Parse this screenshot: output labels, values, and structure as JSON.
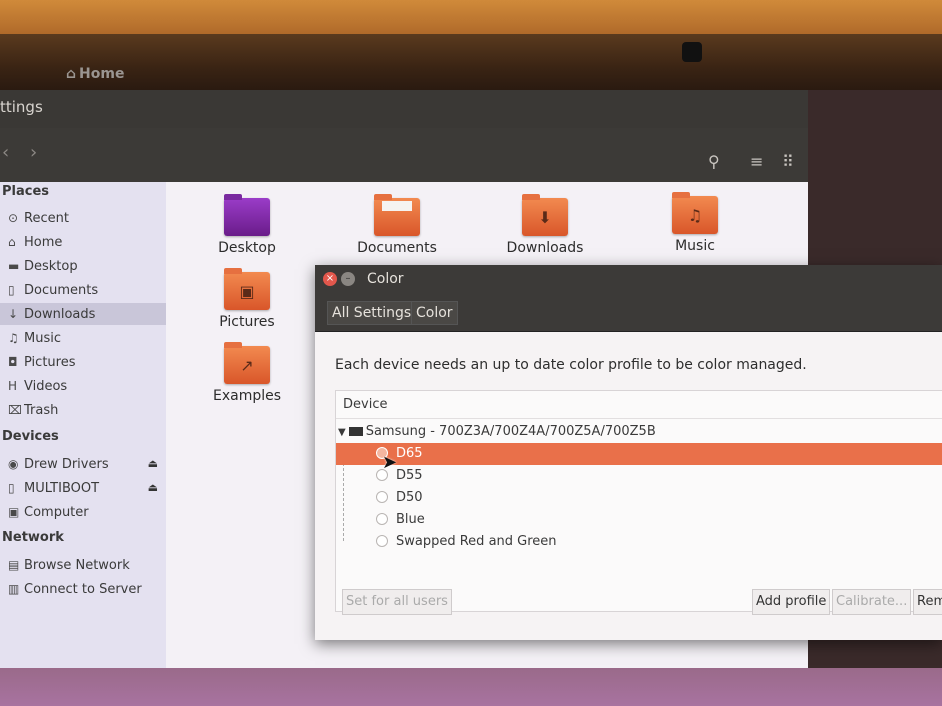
{
  "file_manager": {
    "window_title": "ttings",
    "breadcrumb": {
      "home": "Home"
    },
    "sidebar": {
      "places_label": "Places",
      "places": [
        {
          "label": "Recent",
          "icon": "clock-icon"
        },
        {
          "label": "Home",
          "icon": "home-icon"
        },
        {
          "label": "Desktop",
          "icon": "desktop-folder-icon"
        },
        {
          "label": "Documents",
          "icon": "document-icon"
        },
        {
          "label": "Downloads",
          "icon": "download-icon"
        },
        {
          "label": "Music",
          "icon": "music-icon"
        },
        {
          "label": "Pictures",
          "icon": "camera-icon"
        },
        {
          "label": "Videos",
          "icon": "film-icon"
        },
        {
          "label": "Trash",
          "icon": "trash-icon"
        }
      ],
      "devices_label": "Devices",
      "devices": [
        {
          "label": "Drew Drivers",
          "icon": "disc-icon"
        },
        {
          "label": "MULTIBOOT",
          "icon": "usb-icon"
        },
        {
          "label": "Computer",
          "icon": "computer-icon"
        }
      ],
      "network_label": "Network",
      "network": [
        {
          "label": "Browse Network",
          "icon": "network-icon"
        },
        {
          "label": "Connect to Server",
          "icon": "server-icon"
        }
      ]
    },
    "files": [
      {
        "label": "Desktop"
      },
      {
        "label": "Documents"
      },
      {
        "label": "Downloads"
      },
      {
        "label": "Music"
      },
      {
        "label": "Pictures"
      },
      {
        "label": "Examples"
      }
    ]
  },
  "color_dialog": {
    "title": "Color",
    "breadcrumbs": [
      "All Settings",
      "Color"
    ],
    "description": "Each device needs an up to date color profile to be color managed.",
    "list_header": "Device",
    "device_name": "Samsung - 700Z3A/700Z4A/700Z5A/700Z5B",
    "profiles": [
      {
        "name": "D65",
        "selected": true
      },
      {
        "name": "D55",
        "selected": false
      },
      {
        "name": "D50",
        "selected": false
      },
      {
        "name": "Blue",
        "selected": false
      },
      {
        "name": "Swapped Red and Green",
        "selected": false
      }
    ],
    "buttons": {
      "set_for_all": "Set for all users",
      "add_profile": "Add profile",
      "calibrate": "Calibrate...",
      "remove": "Rem"
    }
  },
  "colors": {
    "accent": "#e9704a",
    "folder": "#e5683a",
    "sidebar_bg": "#e4e1f0"
  }
}
